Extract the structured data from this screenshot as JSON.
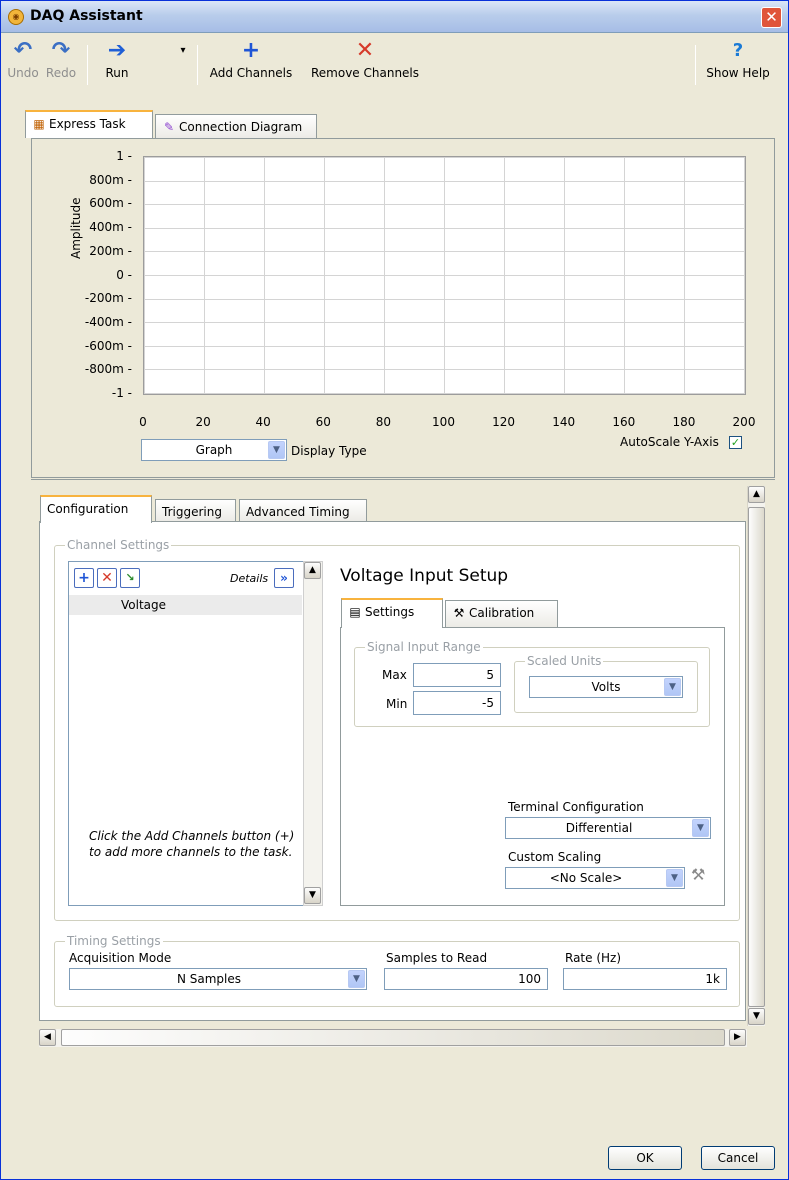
{
  "window": {
    "title": "DAQ Assistant"
  },
  "toolbar": {
    "undo": "Undo",
    "redo": "Redo",
    "run": "Run",
    "add_channels": "Add Channels",
    "remove_channels": "Remove Channels",
    "show_help": "Show Help"
  },
  "top_tabs": [
    {
      "label": "Express Task",
      "active": true
    },
    {
      "label": "Connection Diagram",
      "active": false
    }
  ],
  "chart_data": {
    "type": "line",
    "series": [],
    "xlabel": "",
    "ylabel": "Amplitude",
    "xlim": [
      0,
      200
    ],
    "ylim": [
      -1,
      1
    ],
    "x_ticks": [
      "0",
      "20",
      "40",
      "60",
      "80",
      "100",
      "120",
      "140",
      "160",
      "180",
      "200"
    ],
    "y_ticks": [
      "1",
      "800m",
      "600m",
      "400m",
      "200m",
      "0",
      "-200m",
      "-400m",
      "-600m",
      "-800m",
      "-1"
    ],
    "grid": true
  },
  "graph_controls": {
    "display_type_value": "Graph",
    "display_type_label": "Display Type",
    "autoscale_label": "AutoScale Y-Axis",
    "autoscale_checked": true
  },
  "lower_tabs": [
    {
      "label": "Configuration",
      "active": true
    },
    {
      "label": "Triggering",
      "active": false
    },
    {
      "label": "Advanced Timing",
      "active": false
    }
  ],
  "channel_settings": {
    "title": "Channel Settings",
    "details_label": "Details",
    "channels": [
      "Voltage"
    ],
    "note": "Click the Add Channels button (+) to add more channels to the task."
  },
  "voltage_setup": {
    "title": "Voltage Input Setup",
    "tabs": [
      {
        "label": "Settings",
        "active": true
      },
      {
        "label": "Calibration",
        "active": false
      }
    ],
    "signal_range_title": "Signal Input Range",
    "max_label": "Max",
    "max_value": "5",
    "min_label": "Min",
    "min_value": "-5",
    "scaled_units_title": "Scaled Units",
    "scaled_units_value": "Volts",
    "terminal_config_label": "Terminal Configuration",
    "terminal_config_value": "Differential",
    "custom_scaling_label": "Custom Scaling",
    "custom_scaling_value": "<No Scale>"
  },
  "timing_settings": {
    "title": "Timing Settings",
    "acq_mode_label": "Acquisition Mode",
    "acq_mode_value": "N Samples",
    "samples_label": "Samples to Read",
    "samples_value": "100",
    "rate_label": "Rate (Hz)",
    "rate_value": "1k"
  },
  "footer": {
    "ok": "OK",
    "cancel": "Cancel"
  }
}
